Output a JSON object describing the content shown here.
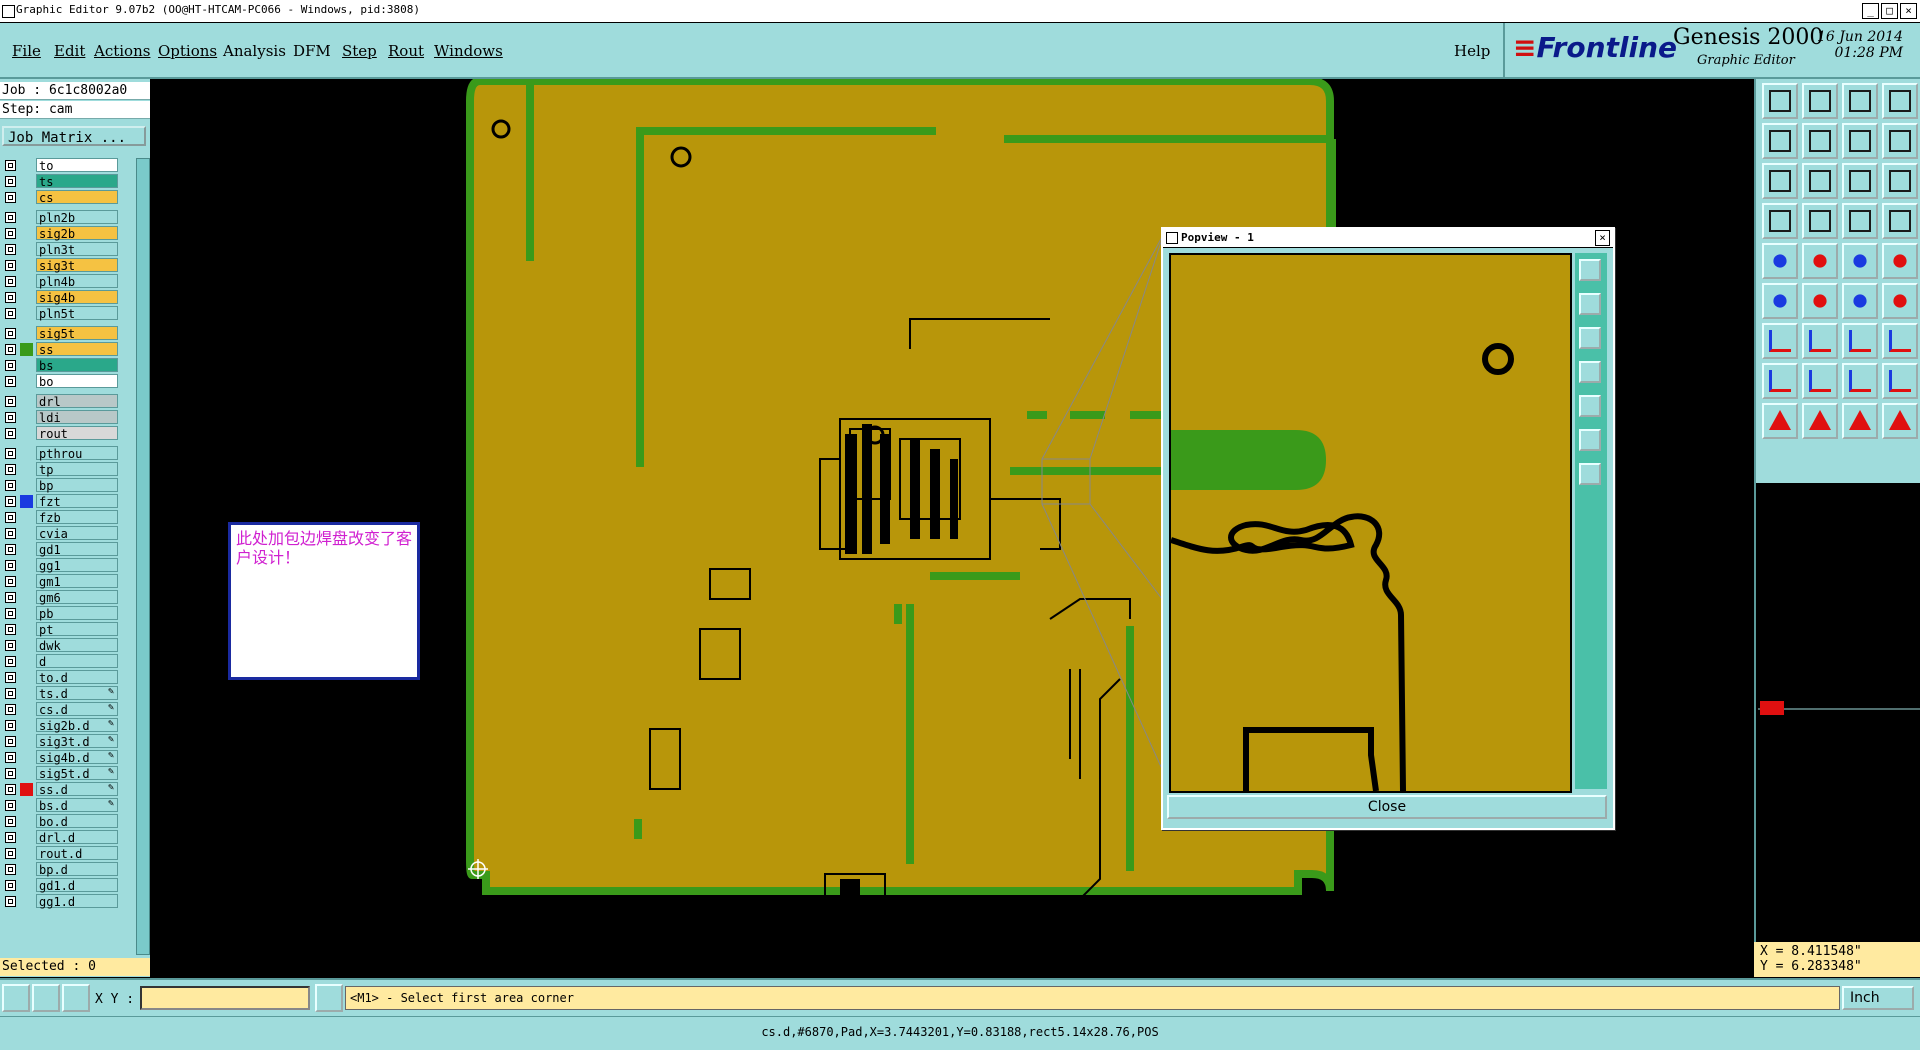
{
  "window": {
    "title": "Graphic Editor 9.07b2 (OO@HT-HTCAM-PC066 - Windows, pid:3808)"
  },
  "menu": {
    "items": [
      "File",
      "Edit",
      "Actions",
      "Options",
      "Analysis",
      "DFM",
      "Step",
      "Rout",
      "Windows"
    ],
    "help": "Help"
  },
  "brand": {
    "logo_prefix": "≡",
    "logo": "Frontline",
    "product": "Genesis 2000",
    "subtitle": "Graphic Editor",
    "date": "16 Jun 2014",
    "time": "01:28 PM"
  },
  "job": {
    "job_line": "Job  : 6c1c8002a0",
    "step_line": "Step: cam",
    "job_matrix": "Job Matrix ..."
  },
  "layers": [
    {
      "name": "to",
      "color": "#ffffff",
      "swatch": ""
    },
    {
      "name": "ts",
      "color": "#2aa88a",
      "swatch": ""
    },
    {
      "name": "cs",
      "color": "#f5c242",
      "swatch": ""
    },
    {
      "name": "pln2b",
      "color": "#9fdcdc",
      "swatch": ""
    },
    {
      "name": "sig2b",
      "color": "#f5c242",
      "swatch": ""
    },
    {
      "name": "pln3t",
      "color": "#9fdcdc",
      "swatch": ""
    },
    {
      "name": "sig3t",
      "color": "#f5c242",
      "swatch": ""
    },
    {
      "name": "pln4b",
      "color": "#9fdcdc",
      "swatch": ""
    },
    {
      "name": "sig4b",
      "color": "#f5c242",
      "swatch": ""
    },
    {
      "name": "pln5t",
      "color": "#9fdcdc",
      "swatch": ""
    },
    {
      "name": "sig5t",
      "color": "#f5c242",
      "swatch": ""
    },
    {
      "name": "ss",
      "color": "#f5c242",
      "swatch": "#3a9a1a"
    },
    {
      "name": "bs",
      "color": "#2aa88a",
      "swatch": ""
    },
    {
      "name": "bo",
      "color": "#ffffff",
      "swatch": ""
    },
    {
      "name": "drl",
      "color": "#b8c8c8",
      "swatch": ""
    },
    {
      "name": "ldi",
      "color": "#b8c8c8",
      "swatch": ""
    },
    {
      "name": "rout",
      "color": "#d8d8d8",
      "swatch": ""
    },
    {
      "name": "pthrou",
      "color": "#9fdcdc",
      "swatch": ""
    },
    {
      "name": "tp",
      "color": "#9fdcdc",
      "swatch": ""
    },
    {
      "name": "bp",
      "color": "#9fdcdc",
      "swatch": ""
    },
    {
      "name": "fzt",
      "color": "#9fdcdc",
      "swatch": "#1a3ae0"
    },
    {
      "name": "fzb",
      "color": "#9fdcdc",
      "swatch": ""
    },
    {
      "name": "cvia",
      "color": "#9fdcdc",
      "swatch": ""
    },
    {
      "name": "gd1",
      "color": "#9fdcdc",
      "swatch": ""
    },
    {
      "name": "gg1",
      "color": "#9fdcdc",
      "swatch": ""
    },
    {
      "name": "gm1",
      "color": "#9fdcdc",
      "swatch": ""
    },
    {
      "name": "gm6",
      "color": "#9fdcdc",
      "swatch": ""
    },
    {
      "name": "pb",
      "color": "#9fdcdc",
      "swatch": ""
    },
    {
      "name": "pt",
      "color": "#9fdcdc",
      "swatch": ""
    },
    {
      "name": "dwk",
      "color": "#9fdcdc",
      "swatch": ""
    },
    {
      "name": "d",
      "color": "#9fdcdc",
      "swatch": ""
    },
    {
      "name": "to.d",
      "color": "#9fdcdc",
      "swatch": ""
    },
    {
      "name": "ts.d",
      "color": "#9fdcdc",
      "swatch": "",
      "edit": "✎"
    },
    {
      "name": "cs.d",
      "color": "#9fdcdc",
      "swatch": "",
      "edit": "✎"
    },
    {
      "name": "sig2b.d",
      "color": "#9fdcdc",
      "swatch": "",
      "edit": "✎"
    },
    {
      "name": "sig3t.d",
      "color": "#9fdcdc",
      "swatch": "",
      "edit": "✎"
    },
    {
      "name": "sig4b.d",
      "color": "#9fdcdc",
      "swatch": "",
      "edit": "✎"
    },
    {
      "name": "sig5t.d",
      "color": "#9fdcdc",
      "swatch": "",
      "edit": "✎"
    },
    {
      "name": "ss.d",
      "color": "#9fdcdc",
      "swatch": "#e01010",
      "edit": "✎"
    },
    {
      "name": "bs.d",
      "color": "#9fdcdc",
      "swatch": "",
      "edit": "✎"
    },
    {
      "name": "bo.d",
      "color": "#9fdcdc",
      "swatch": ""
    },
    {
      "name": "drl.d",
      "color": "#9fdcdc",
      "swatch": ""
    },
    {
      "name": "rout.d",
      "color": "#9fdcdc",
      "swatch": ""
    },
    {
      "name": "bp.d",
      "color": "#9fdcdc",
      "swatch": ""
    },
    {
      "name": "gd1.d",
      "color": "#9fdcdc",
      "swatch": ""
    },
    {
      "name": "gg1.d",
      "color": "#9fdcdc",
      "swatch": ""
    }
  ],
  "selected": "Selected : 0",
  "note": {
    "text": "此处加包边焊盘改变了客户设计！"
  },
  "popview": {
    "title": "Popview - 1",
    "close_label": "Close"
  },
  "coords": {
    "x": "X =  8.411548\"",
    "y": "Y =  6.283348\""
  },
  "bottom": {
    "xy_label": "X Y :",
    "xy_value": "",
    "prompt": "<M1> - Select first area corner",
    "unit": "Inch"
  },
  "status": "cs.d,#6870,Pad,X=3.7443201,Y=0.83188,rect5.14x28.76,POS",
  "colors": {
    "board": "#b8960a",
    "green": "#3a9a1a",
    "panel": "#9fdcdc"
  }
}
